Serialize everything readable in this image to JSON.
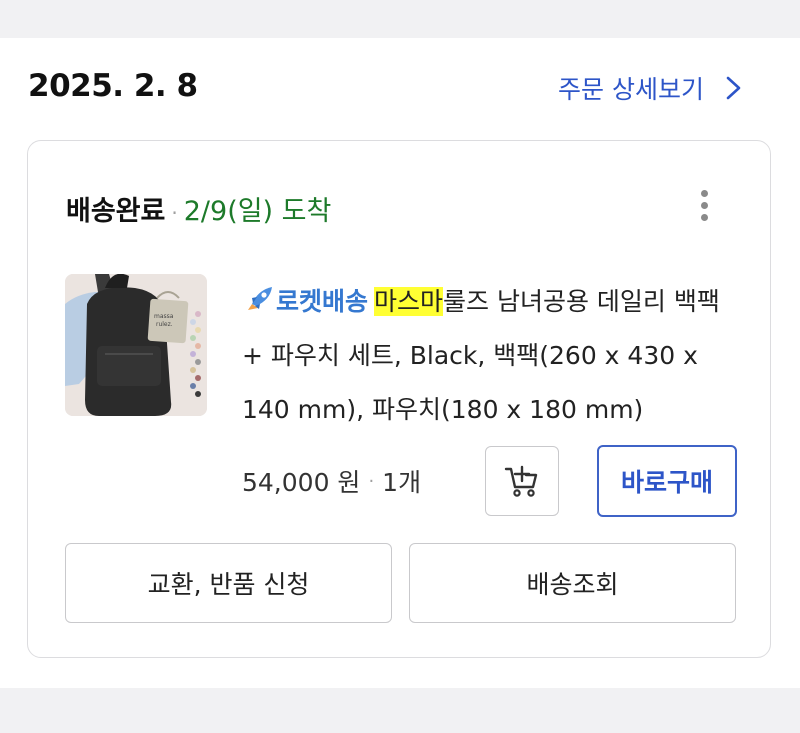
{
  "order": {
    "date": "2025. 2. 8",
    "detail_link": "주문 상세보기"
  },
  "shipment": {
    "status": "배송완료",
    "separator": "·",
    "arrival": "2/9(일) 도착"
  },
  "product": {
    "badge_text": "로켓배송",
    "highlight_text": "마스마",
    "title_rest": "룰즈 남녀공용 데일리 백팩 + 파우치 세트, Black, 백팩(260 x 430 x 140 mm), 파우치(180 x 180 mm)",
    "price": "54,000 원",
    "separator": "·",
    "quantity": "1개",
    "thumbnail_label_line1": "massa",
    "thumbnail_label_line2": "rulez."
  },
  "actions": {
    "buy_now": "바로구매",
    "exchange_return": "교환, 반품 신청",
    "track_delivery": "배송조회"
  },
  "icons": {
    "more": "more-vertical-icon",
    "cart": "add-to-cart-icon",
    "chevron": "chevron-right-icon",
    "rocket": "rocket-icon"
  },
  "colors": {
    "link_blue": "#2d55c8",
    "arrival_green": "#1d7a2a",
    "rocket_blue": "#3578d0",
    "highlight": "#ffff33"
  }
}
